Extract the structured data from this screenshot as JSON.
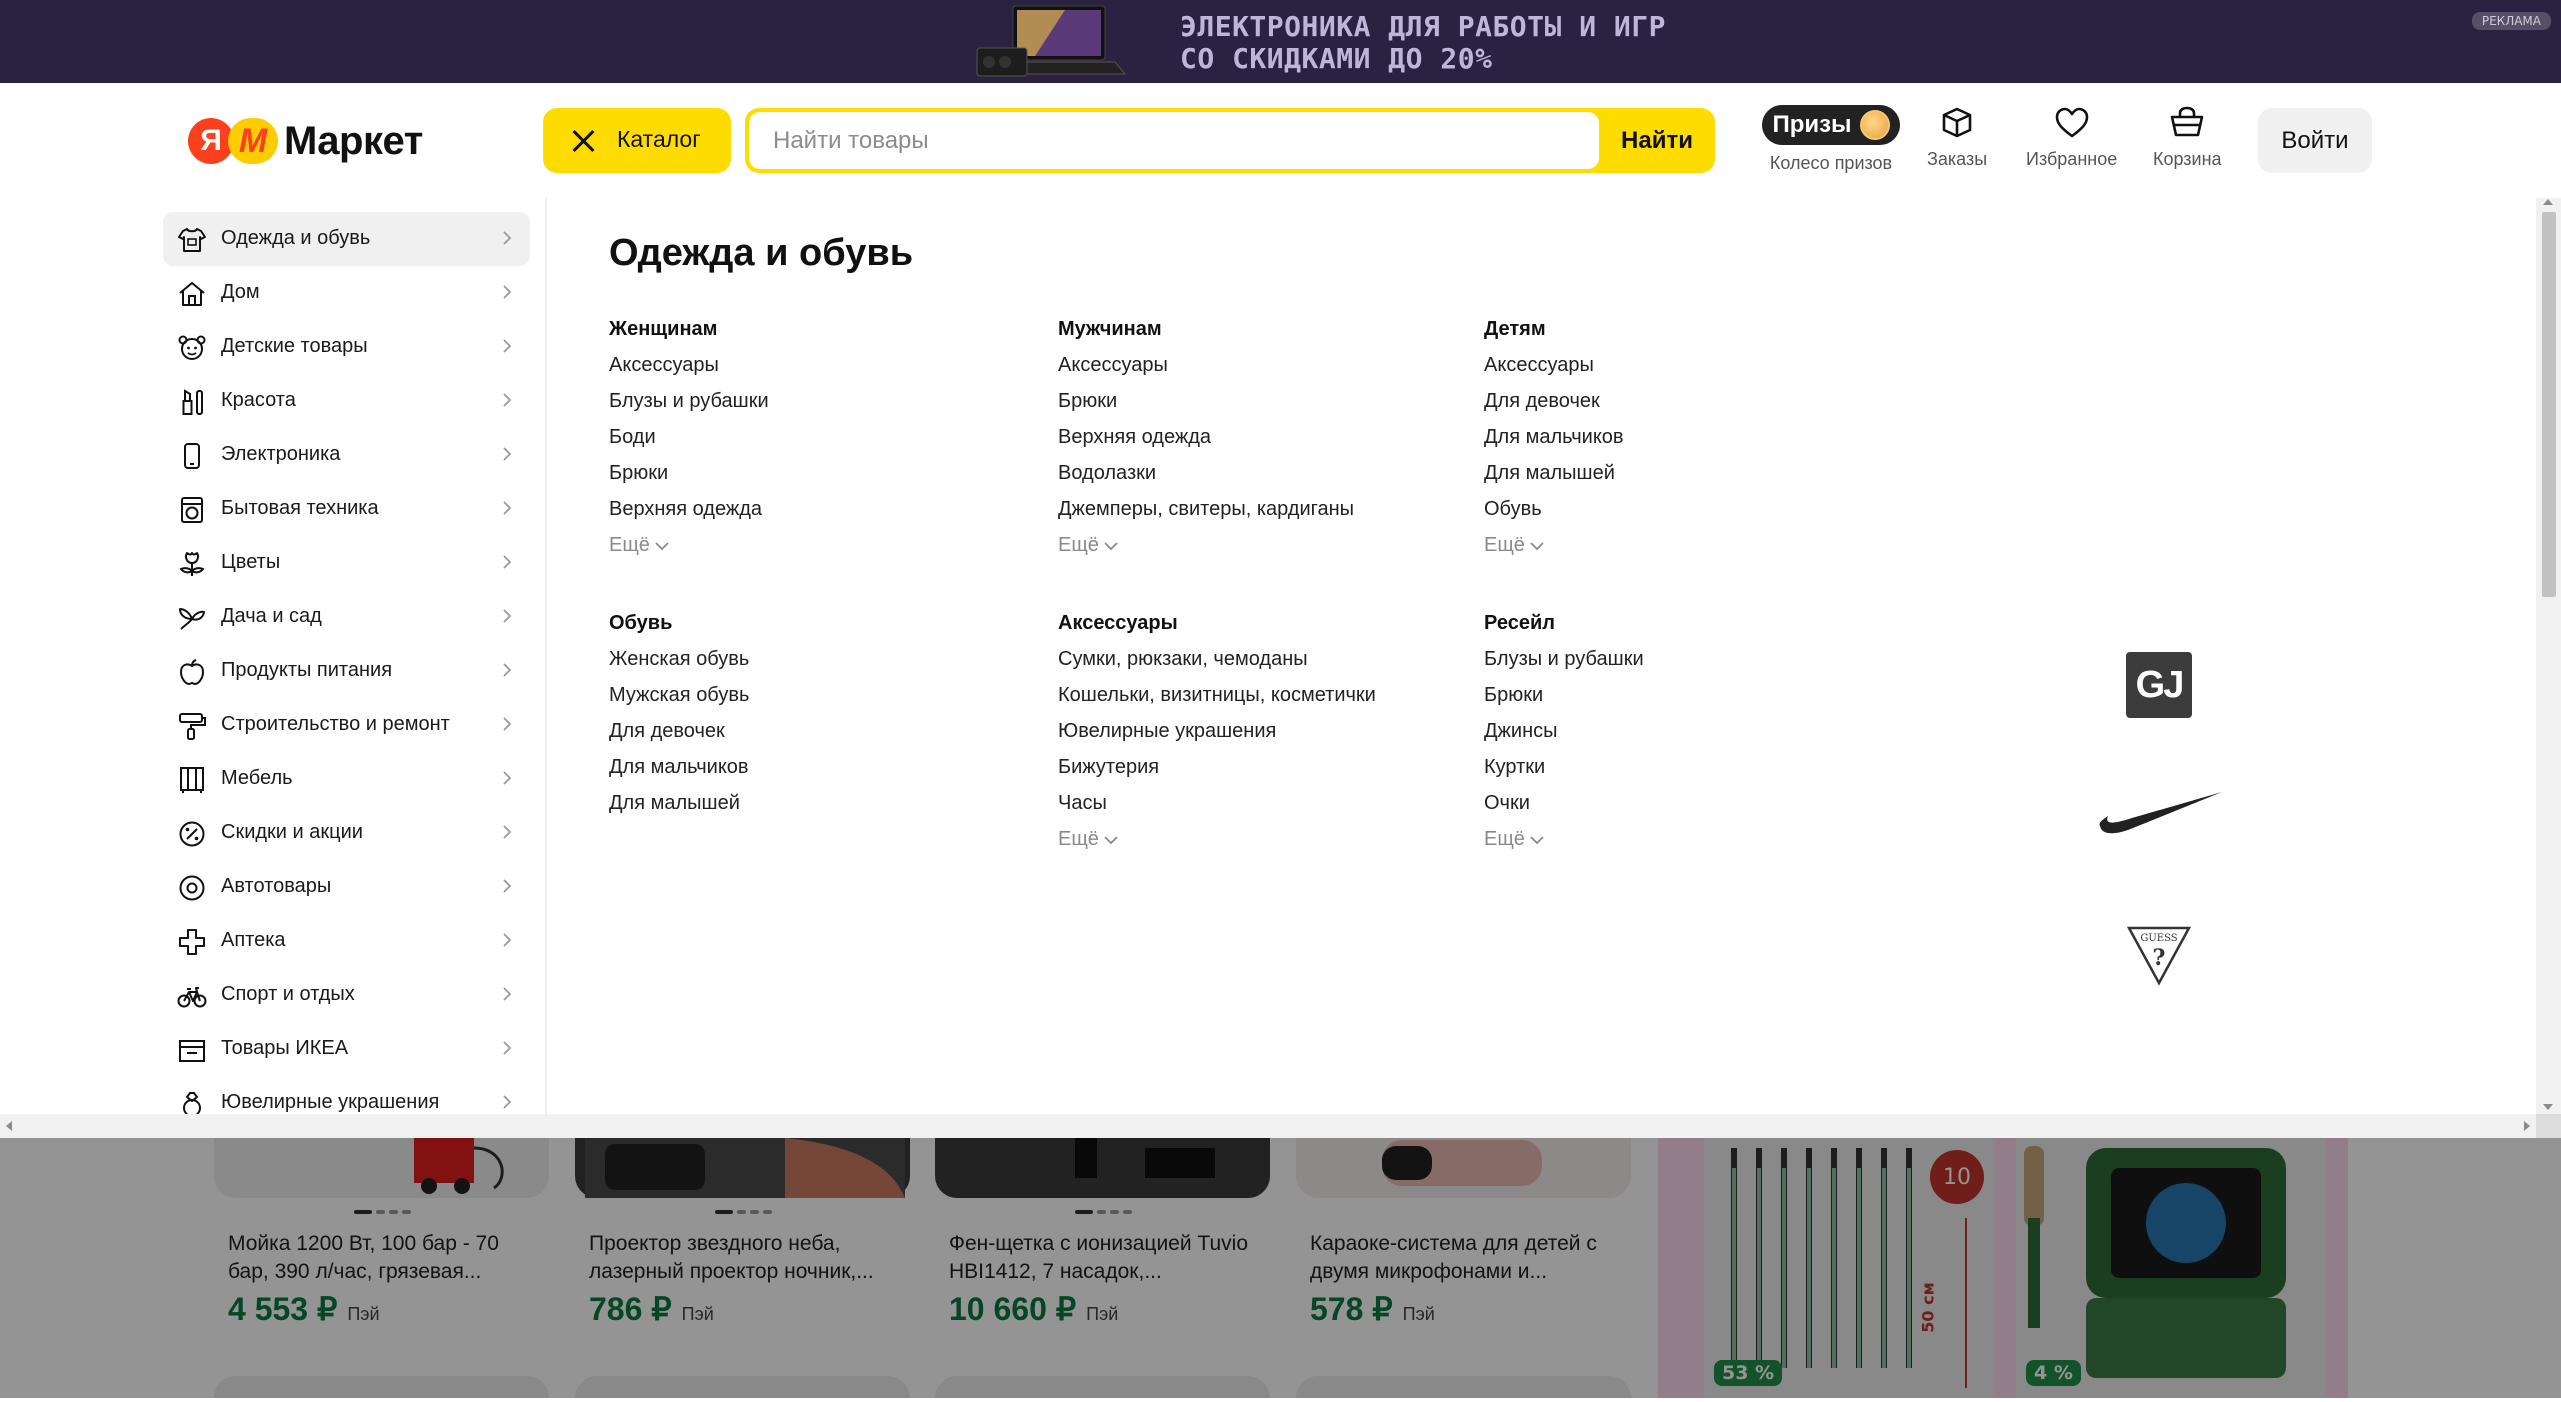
{
  "ad": {
    "line1": "ЭЛЕКТРОНИКА ДЛЯ РАБОТЫ И ИГР",
    "line2": "СО СКИДКАМИ ДО 20%",
    "tag": "РЕКЛАМА"
  },
  "header": {
    "logo_ya": "Я",
    "logo_m": "М",
    "logo_text": "Маркет",
    "catalog_label": "Каталог",
    "search_placeholder": "Найти товары",
    "search_value": "",
    "search_button": "Найти",
    "prizes_pill": "Призы",
    "prizes_caption": "Колесо призов",
    "orders": "Заказы",
    "favorites": "Избранное",
    "cart": "Корзина",
    "login": "Войти"
  },
  "sidebar": {
    "items": [
      {
        "label": "Одежда и обувь",
        "icon": "clothes-icon",
        "active": true
      },
      {
        "label": "Дом",
        "icon": "house-icon"
      },
      {
        "label": "Детские товары",
        "icon": "kids-icon"
      },
      {
        "label": "Красота",
        "icon": "lipstick-icon"
      },
      {
        "label": "Электроника",
        "icon": "phone-icon"
      },
      {
        "label": "Бытовая техника",
        "icon": "washer-icon"
      },
      {
        "label": "Цветы",
        "icon": "flower-icon"
      },
      {
        "label": "Дача и сад",
        "icon": "sprout-icon"
      },
      {
        "label": "Продукты питания",
        "icon": "apple-icon"
      },
      {
        "label": "Строительство и ремонт",
        "icon": "roller-icon"
      },
      {
        "label": "Мебель",
        "icon": "wardrobe-icon"
      },
      {
        "label": "Скидки и акции",
        "icon": "percent-icon"
      },
      {
        "label": "Автотовары",
        "icon": "tire-icon"
      },
      {
        "label": "Аптека",
        "icon": "cross-icon"
      },
      {
        "label": "Спорт и отдых",
        "icon": "bicycle-icon"
      },
      {
        "label": "Товары ИКЕА",
        "icon": "box-icon"
      },
      {
        "label": "Ювелирные украшения",
        "icon": "ring-icon"
      }
    ]
  },
  "content": {
    "title": "Одежда и обувь",
    "more_label": "Ещё",
    "groups": [
      {
        "title": "Женщинам",
        "links": [
          "Аксессуары",
          "Блузы и рубашки",
          "Боди",
          "Брюки",
          "Верхняя одежда"
        ],
        "more": true
      },
      {
        "title": "Мужчинам",
        "links": [
          "Аксессуары",
          "Брюки",
          "Верхняя одежда",
          "Водолазки",
          "Джемперы, свитеры, кардиганы"
        ],
        "more": true
      },
      {
        "title": "Детям",
        "links": [
          "Аксессуары",
          "Для девочек",
          "Для мальчиков",
          "Для малышей",
          "Обувь"
        ],
        "more": true
      },
      {
        "title": "Обувь",
        "links": [
          "Женская обувь",
          "Мужская обувь",
          "Для девочек",
          "Для мальчиков",
          "Для малышей"
        ],
        "more": false
      },
      {
        "title": "Аксессуары",
        "links": [
          "Сумки, рюкзаки, чемоданы",
          "Кошельки, визитницы, косметички",
          "Ювелирные украшения",
          "Бижутерия",
          "Часы"
        ],
        "more": true
      },
      {
        "title": "Ресейл",
        "links": [
          "Блузы и рубашки",
          "Брюки",
          "Джинсы",
          "Куртки",
          "Очки"
        ],
        "more": true
      }
    ],
    "brands": [
      "GJ",
      "nike",
      "GUESS"
    ]
  },
  "background_products": [
    {
      "title": "Мойка 1200 Вт, 100 бар - 70 бар, 390 л/час, грязевая...",
      "price": "4 553 ₽",
      "pay": "Пэй"
    },
    {
      "title": "Проектор звездного неба, лазерный проектор ночник,...",
      "price": "786 ₽",
      "pay": "Пэй"
    },
    {
      "title": "Фен-щетка с ионизацией Tuvio HBI1412, 7 насадок,...",
      "price": "10 660 ₽",
      "pay": "Пэй"
    },
    {
      "title": "Караоке-система для детей с двумя микрофонами и...",
      "price": "578 ₽",
      "pay": "Пэй"
    }
  ],
  "promo": {
    "badge_left": "53 %",
    "badge_right": "4 %",
    "ten": "10",
    "cm": "50 см"
  },
  "colors": {
    "accent_yellow": "#ffdc00",
    "brand_red": "#fc3f1d",
    "price_green": "#0a7a3e",
    "ad_bg": "#2b2140"
  }
}
